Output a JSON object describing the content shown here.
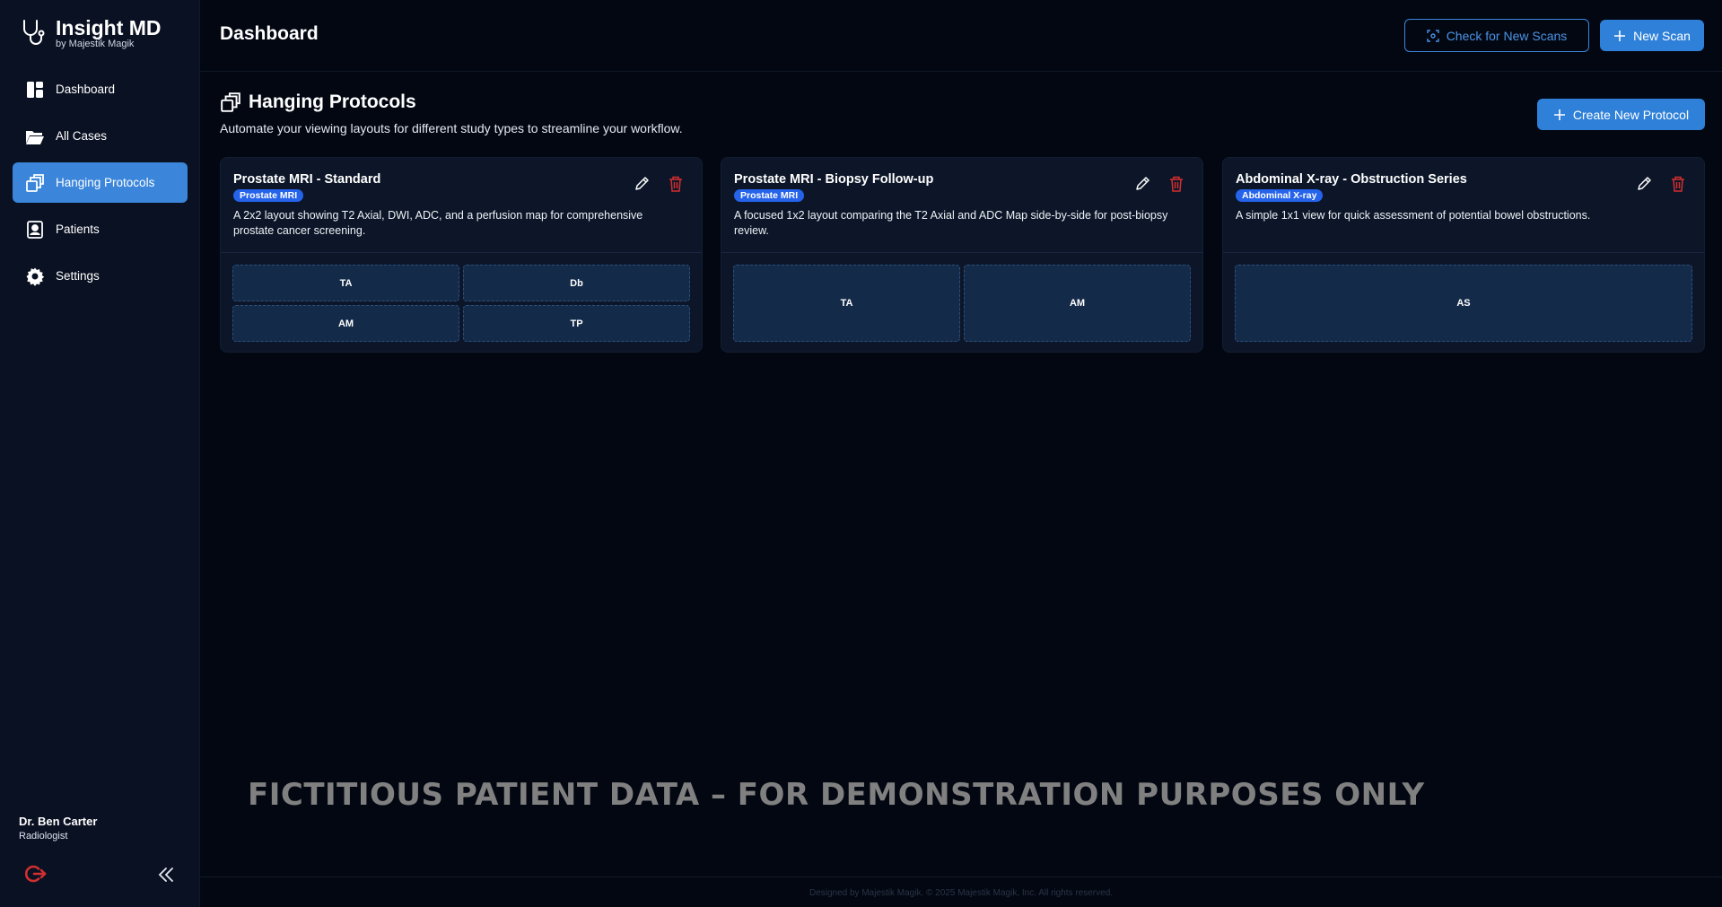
{
  "brand": {
    "title": "Insight MD",
    "subtitle": "by Majestik Magik"
  },
  "sidebar": {
    "items": [
      {
        "label": "Dashboard",
        "icon": "dashboard-icon",
        "active": false
      },
      {
        "label": "All Cases",
        "icon": "folder-icon",
        "active": false
      },
      {
        "label": "Hanging Protocols",
        "icon": "layout-windows-icon",
        "active": true
      },
      {
        "label": "Patients",
        "icon": "patient-card-icon",
        "active": false
      },
      {
        "label": "Settings",
        "icon": "gear-icon",
        "active": false
      }
    ],
    "user": {
      "name": "Dr. Ben Carter",
      "role": "Radiologist"
    }
  },
  "header": {
    "title": "Dashboard",
    "check_scans_label": "Check for New Scans",
    "new_scan_label": "New Scan"
  },
  "section": {
    "title": "Hanging Protocols",
    "description": "Automate your viewing layouts for different study types to streamline your workflow.",
    "create_label": "Create New Protocol"
  },
  "protocols": [
    {
      "title": "Prostate MRI - Standard",
      "badge": "Prostate MRI",
      "description": "A 2x2 layout showing T2 Axial, DWI, ADC, and a perfusion map for comprehensive prostate cancer screening.",
      "cells": [
        "TA",
        "Db",
        "AM",
        "TP"
      ]
    },
    {
      "title": "Prostate MRI - Biopsy Follow-up",
      "badge": "Prostate MRI",
      "description": "A focused 1x2 layout comparing the T2 Axial and ADC Map side-by-side for post-biopsy review.",
      "cells": [
        "TA",
        "AM"
      ]
    },
    {
      "title": "Abdominal X-ray - Obstruction Series",
      "badge": "Abdominal X-ray",
      "description": "A simple 1x1 view for quick assessment of potential bowel obstructions.",
      "cells": [
        "AS"
      ]
    }
  ],
  "watermark": "FICTITIOUS PATIENT DATA – FOR DEMONSTRATION PURPOSES ONLY",
  "footer": "Designed by Majestik Magik. © 2025 Majestik Magik, Inc. All rights reserved.",
  "colors": {
    "accent": "#2e80d8",
    "danger": "#d32f2f",
    "badge": "#2563eb",
    "background": "#030712"
  }
}
